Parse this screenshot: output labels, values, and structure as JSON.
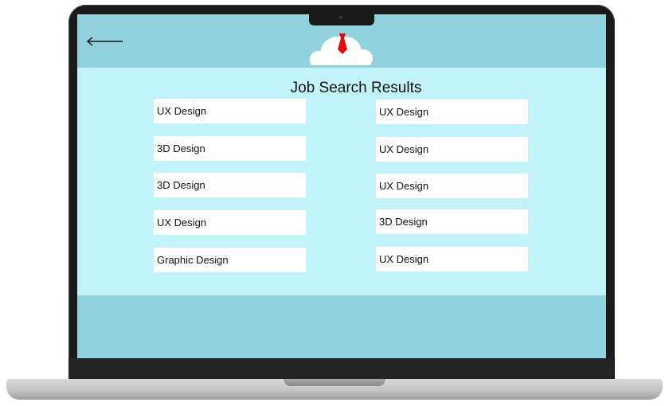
{
  "header": {
    "back_icon": "left-arrow-icon",
    "logo_icon": "cloud-with-tie-icon"
  },
  "page_title": "Job Search Results",
  "results": {
    "left": [
      "UX Design",
      "3D Design",
      "3D Design",
      "UX Design",
      "Graphic  Design"
    ],
    "right": [
      "UX Design",
      "UX Design",
      "UX Design",
      "3D Design",
      "UX Design"
    ]
  },
  "colors": {
    "header_bg": "#92d1de",
    "content_bg": "#c2f3fb",
    "card_bg": "#ffffff",
    "tie_red": "#e10a0a"
  }
}
